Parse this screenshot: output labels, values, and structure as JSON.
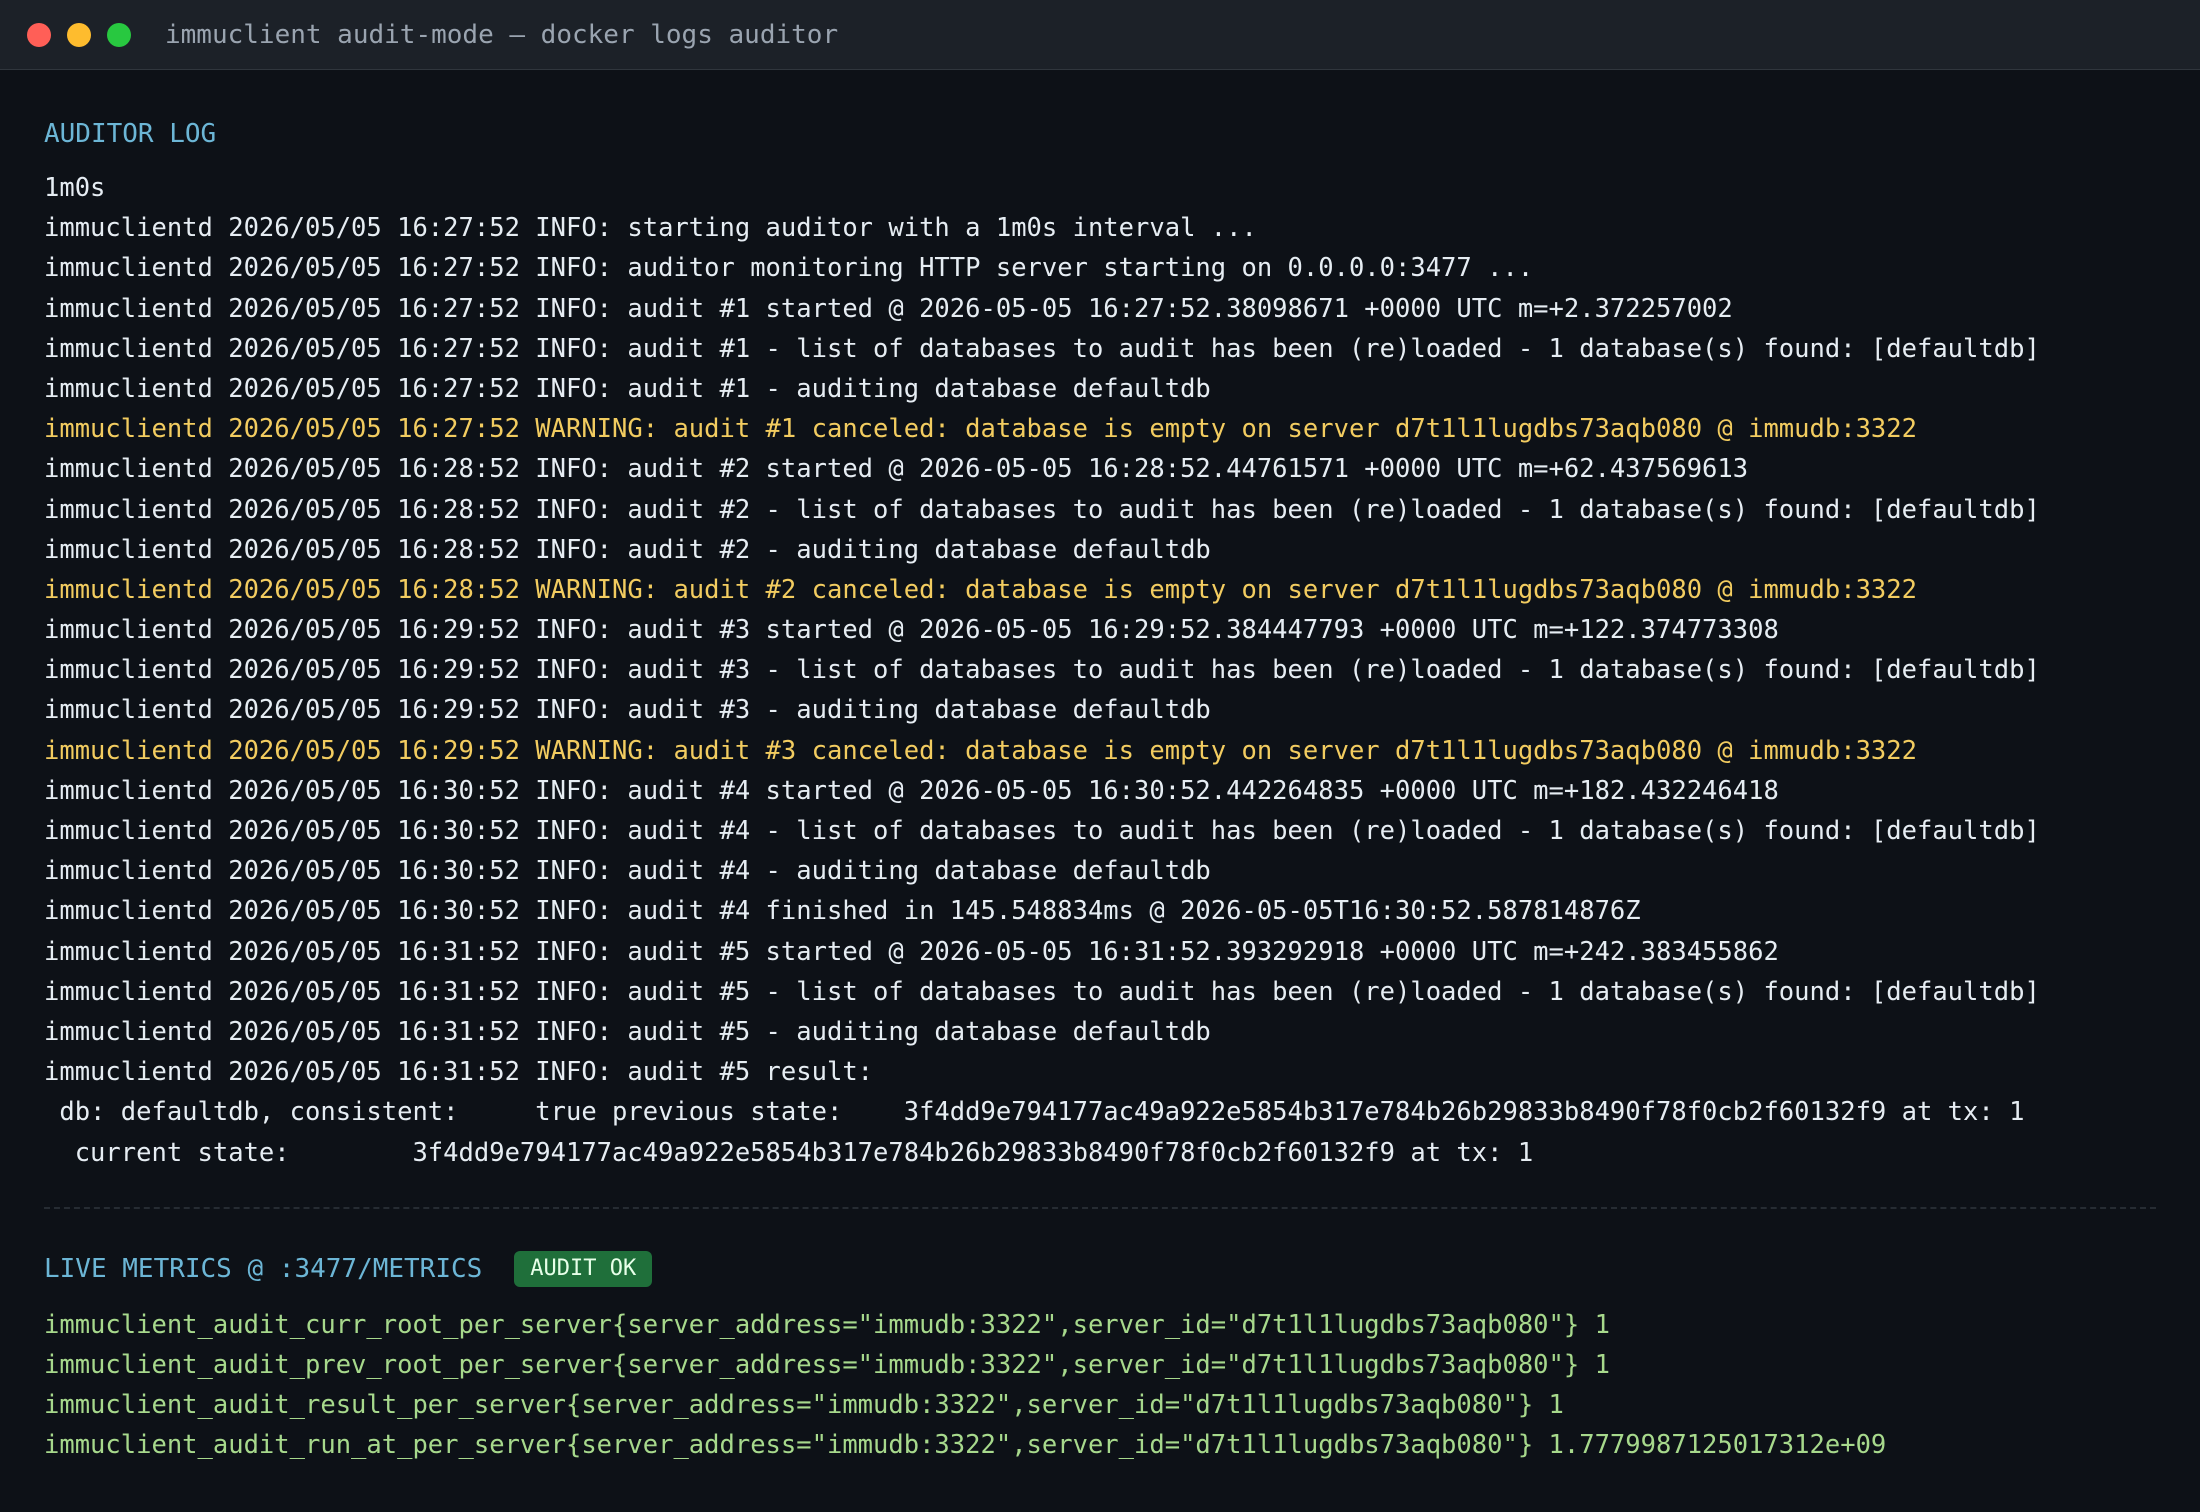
{
  "window": {
    "title": "immuclient audit-mode — docker logs auditor"
  },
  "auditor_log": {
    "heading": "AUDITOR LOG",
    "lines": [
      {
        "text": "1m0s",
        "level": "plain"
      },
      {
        "text": "immuclientd 2026/05/05 16:27:52 INFO: starting auditor with a 1m0s interval ...",
        "level": "info"
      },
      {
        "text": "immuclientd 2026/05/05 16:27:52 INFO: auditor monitoring HTTP server starting on 0.0.0.0:3477 ...",
        "level": "info"
      },
      {
        "text": "immuclientd 2026/05/05 16:27:52 INFO: audit #1 started @ 2026-05-05 16:27:52.38098671 +0000 UTC m=+2.372257002",
        "level": "info"
      },
      {
        "text": "immuclientd 2026/05/05 16:27:52 INFO: audit #1 - list of databases to audit has been (re)loaded - 1 database(s) found: [defaultdb]",
        "level": "info"
      },
      {
        "text": "immuclientd 2026/05/05 16:27:52 INFO: audit #1 - auditing database defaultdb",
        "level": "info"
      },
      {
        "text": "immuclientd 2026/05/05 16:27:52 WARNING: audit #1 canceled: database is empty on server d7t1l1lugdbs73aqb080 @ immudb:3322",
        "level": "warning"
      },
      {
        "text": "immuclientd 2026/05/05 16:28:52 INFO: audit #2 started @ 2026-05-05 16:28:52.44761571 +0000 UTC m=+62.437569613",
        "level": "info"
      },
      {
        "text": "immuclientd 2026/05/05 16:28:52 INFO: audit #2 - list of databases to audit has been (re)loaded - 1 database(s) found: [defaultdb]",
        "level": "info"
      },
      {
        "text": "immuclientd 2026/05/05 16:28:52 INFO: audit #2 - auditing database defaultdb",
        "level": "info"
      },
      {
        "text": "immuclientd 2026/05/05 16:28:52 WARNING: audit #2 canceled: database is empty on server d7t1l1lugdbs73aqb080 @ immudb:3322",
        "level": "warning"
      },
      {
        "text": "immuclientd 2026/05/05 16:29:52 INFO: audit #3 started @ 2026-05-05 16:29:52.384447793 +0000 UTC m=+122.374773308",
        "level": "info"
      },
      {
        "text": "immuclientd 2026/05/05 16:29:52 INFO: audit #3 - list of databases to audit has been (re)loaded - 1 database(s) found: [defaultdb]",
        "level": "info"
      },
      {
        "text": "immuclientd 2026/05/05 16:29:52 INFO: audit #3 - auditing database defaultdb",
        "level": "info"
      },
      {
        "text": "immuclientd 2026/05/05 16:29:52 WARNING: audit #3 canceled: database is empty on server d7t1l1lugdbs73aqb080 @ immudb:3322",
        "level": "warning"
      },
      {
        "text": "immuclientd 2026/05/05 16:30:52 INFO: audit #4 started @ 2026-05-05 16:30:52.442264835 +0000 UTC m=+182.432246418",
        "level": "info"
      },
      {
        "text": "immuclientd 2026/05/05 16:30:52 INFO: audit #4 - list of databases to audit has been (re)loaded - 1 database(s) found: [defaultdb]",
        "level": "info"
      },
      {
        "text": "immuclientd 2026/05/05 16:30:52 INFO: audit #4 - auditing database defaultdb",
        "level": "info"
      },
      {
        "text": "immuclientd 2026/05/05 16:30:52 INFO: audit #4 finished in 145.548834ms @ 2026-05-05T16:30:52.587814876Z",
        "level": "info"
      },
      {
        "text": "immuclientd 2026/05/05 16:31:52 INFO: audit #5 started @ 2026-05-05 16:31:52.393292918 +0000 UTC m=+242.383455862",
        "level": "info"
      },
      {
        "text": "immuclientd 2026/05/05 16:31:52 INFO: audit #5 - list of databases to audit has been (re)loaded - 1 database(s) found: [defaultdb]",
        "level": "info"
      },
      {
        "text": "immuclientd 2026/05/05 16:31:52 INFO: audit #5 - auditing database defaultdb",
        "level": "info"
      },
      {
        "text": "immuclientd 2026/05/05 16:31:52 INFO: audit #5 result:",
        "level": "info"
      },
      {
        "text": " db: defaultdb, consistent:     true previous state:    3f4dd9e794177ac49a922e5854b317e784b26b29833b8490f78f0cb2f60132f9 at tx: 1",
        "level": "info"
      },
      {
        "text": "  current state:        3f4dd9e794177ac49a922e5854b317e784b26b29833b8490f78f0cb2f60132f9 at tx: 1",
        "level": "info"
      }
    ]
  },
  "live_metrics": {
    "heading": "LIVE METRICS @ :3477/METRICS",
    "badge": "AUDIT OK",
    "lines": [
      "immuclient_audit_curr_root_per_server{server_address=\"immudb:3322\",server_id=\"d7t1l1lugdbs73aqb080\"} 1",
      "immuclient_audit_prev_root_per_server{server_address=\"immudb:3322\",server_id=\"d7t1l1lugdbs73aqb080\"} 1",
      "immuclient_audit_result_per_server{server_address=\"immudb:3322\",server_id=\"d7t1l1lugdbs73aqb080\"} 1",
      "immuclient_audit_run_at_per_server{server_address=\"immudb:3322\",server_id=\"d7t1l1lugdbs73aqb080\"} 1.7779987125017312e+09"
    ]
  },
  "colors": {
    "background": "#0d1117",
    "titlebar": "#1c2128",
    "info_text": "#e6edf3",
    "warning_text": "#f2cc60",
    "heading_text": "#6cb6d6",
    "metric_text": "#a7d98c",
    "badge_bg": "#1f6f3a",
    "close": "#ff5f57",
    "minimize": "#febc2e",
    "maximize": "#28c840"
  }
}
